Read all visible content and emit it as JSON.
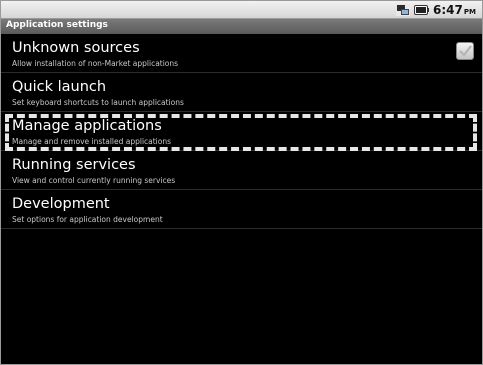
{
  "status_bar": {
    "time": "6:47",
    "ampm": "PM",
    "icons": [
      "network-icon",
      "battery-icon"
    ]
  },
  "title_bar": {
    "title": "Application settings"
  },
  "settings": [
    {
      "label": "Unknown sources",
      "summary": "Allow installation of non-Market applications",
      "checked": true
    },
    {
      "label": "Quick launch",
      "summary": "Set keyboard shortcuts to launch applications"
    },
    {
      "label": "Manage applications",
      "summary": "Manage and remove installed applications",
      "highlighted": true
    },
    {
      "label": "Running services",
      "summary": "View and control currently running services"
    },
    {
      "label": "Development",
      "summary": "Set options for application development"
    }
  ]
}
